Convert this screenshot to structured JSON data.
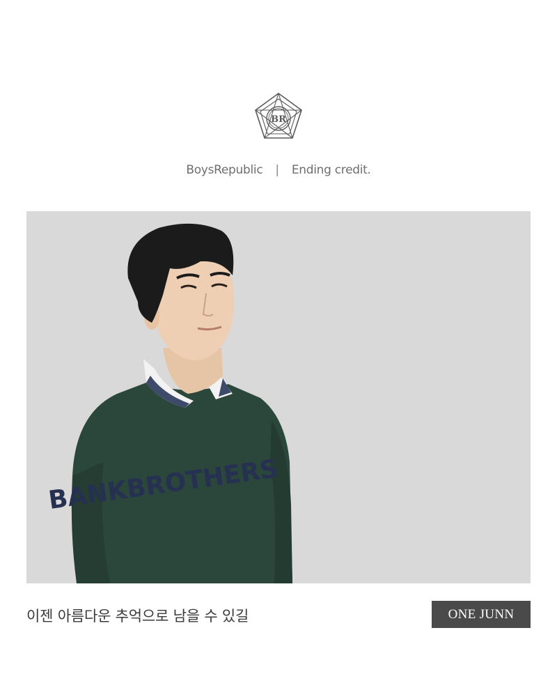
{
  "header": {
    "logo_monogram": "BR",
    "brand": "BoysRepublic",
    "separator": "|",
    "subtitle": "Ending credit."
  },
  "photo": {
    "background_color": "#d9d9d9",
    "sweater_color": "#2b463b",
    "sweater_print": "BANKBROTHERS"
  },
  "footer": {
    "caption": "이젠 아름다운 추억으로 남을 수 있길",
    "member_name": "ONE JUNN",
    "badge_color": "#4a4a4a"
  }
}
